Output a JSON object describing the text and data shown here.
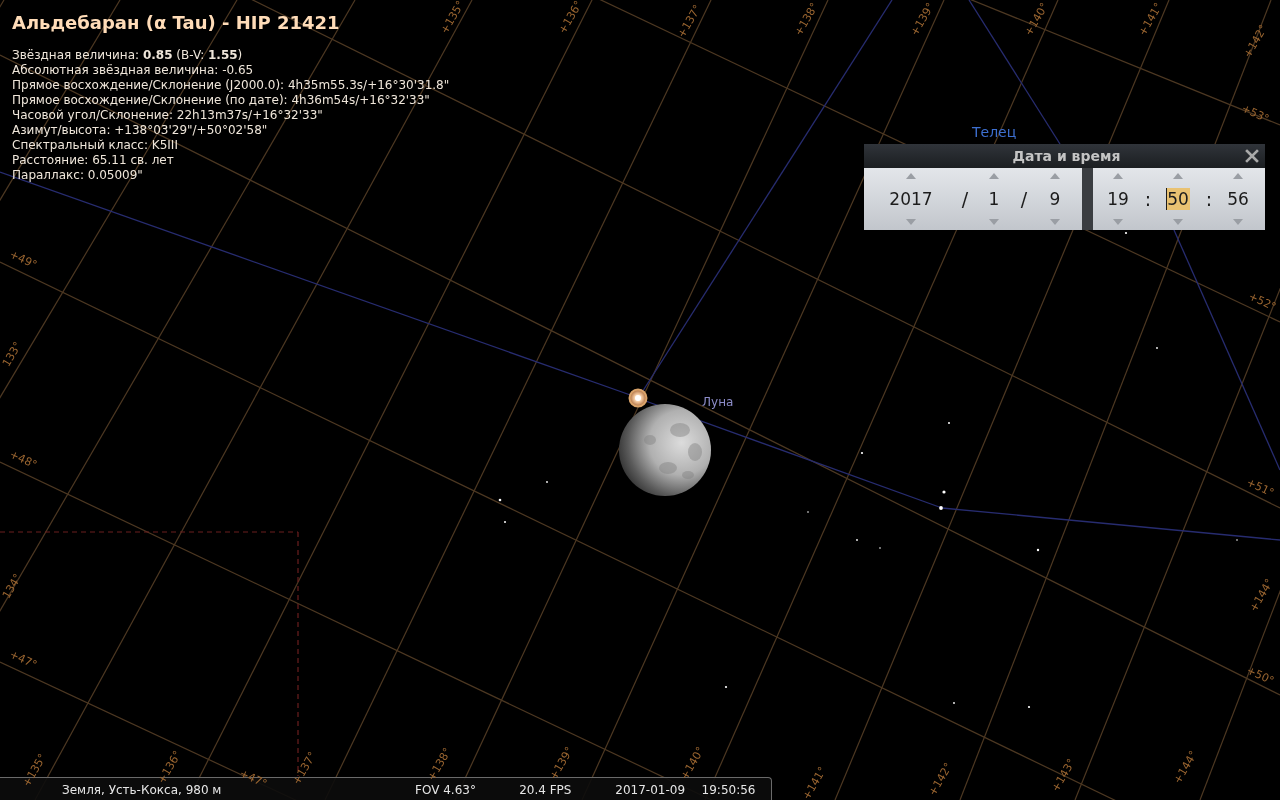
{
  "object_info": {
    "title": "Альдебаран (α Tau) - HIP 21421",
    "details": [
      "Звёздная величина: **0.85** (B-V: **1.55**)",
      "Абсолютная звёздная величина: -0.65",
      "Прямое восхождение/Склонение (J2000.0): 4h35m55.3s/+16°30'31.8\"",
      "Прямое восхождение/Склонение (по дате): 4h36m54s/+16°32'33\"",
      "Часовой угол/Склонение: 22h13m37s/+16°32'33\"",
      "Азимут/высота: +138°03'29\"/+50°02'58\"",
      "Спектральный класс: K5III",
      "Расстояние: 65.11 св. лет",
      "Параллакс: 0.05009\""
    ]
  },
  "sky": {
    "constellation_name": "Телец",
    "moon_label": "Луна",
    "grid_labels": [
      {
        "text": "+135°",
        "kind": "azimuth"
      },
      {
        "text": "+136°",
        "kind": "azimuth"
      },
      {
        "text": "+137°",
        "kind": "azimuth"
      },
      {
        "text": "+138°",
        "kind": "azimuth"
      },
      {
        "text": "+139°",
        "kind": "azimuth"
      },
      {
        "text": "+140°",
        "kind": "azimuth"
      },
      {
        "text": "+141°",
        "kind": "azimuth"
      },
      {
        "text": "+142°",
        "kind": "azimuth"
      },
      {
        "text": "+53°",
        "kind": "altitude"
      },
      {
        "text": "+49°",
        "kind": "altitude"
      },
      {
        "text": "+52°",
        "kind": "altitude"
      },
      {
        "text": "133°",
        "kind": "azimuth"
      },
      {
        "text": "+48°",
        "kind": "altitude"
      },
      {
        "text": "+51°",
        "kind": "altitude"
      },
      {
        "text": "134°",
        "kind": "azimuth"
      },
      {
        "text": "+144°",
        "kind": "azimuth"
      },
      {
        "text": "+47°",
        "kind": "altitude"
      },
      {
        "text": "+50°",
        "kind": "altitude"
      },
      {
        "text": "+135°",
        "kind": "azimuth"
      },
      {
        "text": "+136°",
        "kind": "azimuth"
      },
      {
        "text": "+47°",
        "kind": "altitude"
      },
      {
        "text": "+137°",
        "kind": "azimuth"
      },
      {
        "text": "+138°",
        "kind": "azimuth"
      },
      {
        "text": "+139°",
        "kind": "azimuth"
      },
      {
        "text": "+140°",
        "kind": "azimuth"
      },
      {
        "text": "+141°",
        "kind": "azimuth"
      },
      {
        "text": "+142°",
        "kind": "azimuth"
      },
      {
        "text": "+143°",
        "kind": "azimuth"
      },
      {
        "text": "+144°",
        "kind": "azimuth"
      }
    ]
  },
  "date_time_dialog": {
    "title": "Дата и время",
    "date": {
      "fields": [
        {
          "value": "2017",
          "selected": false
        },
        {
          "value": "1",
          "selected": false
        },
        {
          "value": "9",
          "selected": false
        }
      ],
      "separators": [
        "/",
        "/"
      ]
    },
    "time": {
      "fields": [
        {
          "value": "19",
          "selected": false
        },
        {
          "value": "50",
          "selected": true
        },
        {
          "value": "56",
          "selected": false
        }
      ],
      "separators": [
        ":",
        ":"
      ]
    }
  },
  "status_bar": {
    "location": "Земля, Усть-Кокса, 980 м",
    "fov": "FOV 4.63°",
    "fps": "20.4 FPS",
    "date": "2017-01-09",
    "time": "19:50:56"
  }
}
